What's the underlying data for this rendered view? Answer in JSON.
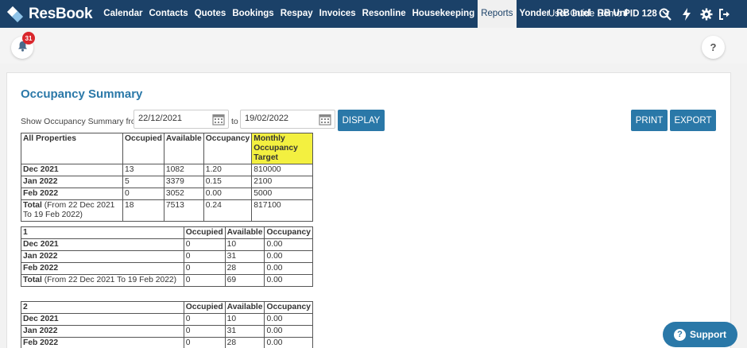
{
  "app": {
    "name": "ResBook"
  },
  "nav": [
    "Calendar",
    "Contacts",
    "Quotes",
    "Bookings",
    "Respay",
    "Invoices",
    "Resonline",
    "Housekeeping",
    "Reports",
    "Yonder",
    "RB Intel",
    "RB Uni"
  ],
  "active_nav": "Reports",
  "user": {
    "label": "User Guide Demo ",
    "pid": "PID 128"
  },
  "notifications": {
    "count": "31"
  },
  "help_label": "?",
  "page": {
    "title": "Occupancy Summary"
  },
  "filter": {
    "label": "Show Occupancy Summary from",
    "from": "22/12/2021",
    "to_label": "to",
    "to": "19/02/2022"
  },
  "buttons": {
    "display": "DISPLAY",
    "print": "PRINT",
    "export": "EXPORT"
  },
  "summary_table": {
    "headers": [
      "All Properties",
      "Occupied",
      "Available",
      "Occupancy",
      "Monthly Occupancy Target"
    ],
    "rows": [
      {
        "label": "Dec 2021",
        "cells": [
          "13",
          "1082",
          "1.20",
          "810000"
        ]
      },
      {
        "label": "Jan 2022",
        "cells": [
          "5",
          "3379",
          "0.15",
          "2100"
        ]
      },
      {
        "label": "Feb 2022",
        "cells": [
          "0",
          "3052",
          "0.00",
          "5000"
        ]
      }
    ],
    "total": {
      "label": "Total",
      "suffix": " (From 22 Dec 2021 To 19 Feb 2022)",
      "cells": [
        "18",
        "7513",
        "0.24",
        "817100"
      ]
    }
  },
  "property_tables": [
    {
      "name": "1",
      "headers": [
        "Occupied",
        "Available",
        "Occupancy"
      ],
      "rows": [
        {
          "label": "Dec 2021",
          "cells": [
            "0",
            "10",
            "0.00"
          ]
        },
        {
          "label": "Jan 2022",
          "cells": [
            "0",
            "31",
            "0.00"
          ]
        },
        {
          "label": "Feb 2022",
          "cells": [
            "0",
            "28",
            "0.00"
          ]
        }
      ],
      "total": {
        "label": "Total",
        "suffix": " (From 22 Dec 2021 To 19 Feb 2022)",
        "cells": [
          "0",
          "69",
          "0.00"
        ]
      }
    },
    {
      "name": "2",
      "headers": [
        "Occupied",
        "Available",
        "Occupancy"
      ],
      "rows": [
        {
          "label": "Dec 2021",
          "cells": [
            "0",
            "10",
            "0.00"
          ]
        },
        {
          "label": "Jan 2022",
          "cells": [
            "0",
            "31",
            "0.00"
          ]
        },
        {
          "label": "Feb 2022",
          "cells": [
            "0",
            "28",
            "0.00"
          ]
        }
      ]
    }
  ],
  "support": {
    "label": "Support"
  },
  "colors": {
    "topbar": "#1b4168",
    "accent": "#2a78a8",
    "highlight": "#f3f040",
    "badge": "#d9262c"
  },
  "icons": [
    "resbook-logo-icon",
    "chevron-down-icon",
    "search-icon",
    "lightning-icon",
    "gear-icon",
    "logout-icon",
    "bell-icon",
    "calendar-icon",
    "help-icon",
    "question-circle-icon"
  ]
}
